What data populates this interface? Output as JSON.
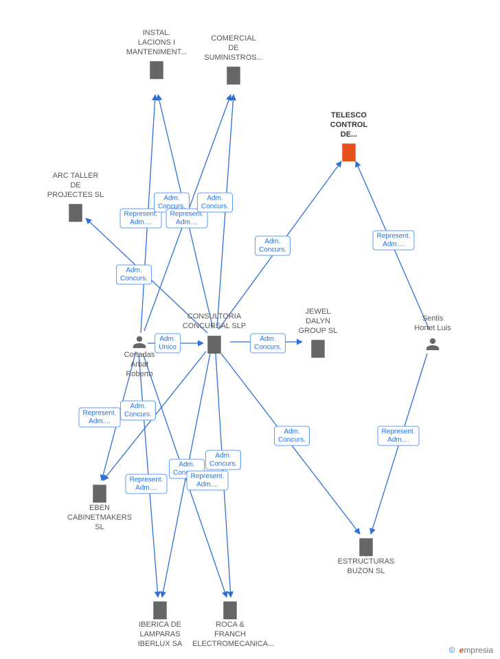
{
  "nodes": {
    "instal": {
      "label": "INSTAL.\nLACIONS I\nMANTENIMENT...",
      "type": "company"
    },
    "comercial": {
      "label": "COMERCIAL\nDE\nSUMINISTROS...",
      "type": "company"
    },
    "telesco": {
      "label": "TELESCO\nCONTROL\nDE...",
      "type": "company",
      "highlight": true
    },
    "arctaller": {
      "label": "ARC TALLER\nDE\nPROJECTES SL",
      "type": "company"
    },
    "consultoria": {
      "label": "CONSULTORIA\nCONCURSAL SLP",
      "type": "company"
    },
    "jewel": {
      "label": "JEWEL\nDALYN\nGROUP SL",
      "type": "company"
    },
    "roberto": {
      "label": "Cortadas\nArbat\nRoberto",
      "type": "person"
    },
    "sentis": {
      "label": "Sentis\nHortet Luis",
      "type": "person"
    },
    "eben": {
      "label": "EBEN\nCABINETMAKERS SL",
      "type": "company"
    },
    "estructuras": {
      "label": "ESTRUCTURAS\nBUZON SL",
      "type": "company"
    },
    "iberica": {
      "label": "IBERICA DE\nLAMPARAS\nIBERLUX SA",
      "type": "company"
    },
    "roca": {
      "label": "ROCA &\nFRANCH\nELECTROMECANICA...",
      "type": "company"
    }
  },
  "edges": {
    "roberto_consultoria": {
      "from": "roberto",
      "to": "consultoria",
      "label": "Adm.\nUnico"
    },
    "consultoria_telesco": {
      "from": "consultoria",
      "to": "telesco",
      "label": "Adm.\nConcurs."
    },
    "sentis_telesco": {
      "from": "sentis",
      "to": "telesco",
      "label": "Represent.\nAdm...."
    },
    "consultoria_jewel": {
      "from": "consultoria",
      "to": "jewel",
      "label": "Adm.\nConcurs."
    },
    "consultoria_estructuras": {
      "from": "consultoria",
      "to": "estructuras",
      "label": "Adm.\nConcurs."
    },
    "sentis_estructuras": {
      "from": "sentis",
      "to": "estructuras",
      "label": "Represent.\nAdm...."
    },
    "consultoria_arctaller": {
      "from": "consultoria",
      "to": "arctaller",
      "label": "Adm.\nConcurs."
    },
    "roberto_instal": {
      "from": "roberto",
      "to": "instal",
      "label": "Represent.\nAdm...."
    },
    "consultoria_instal": {
      "from": "consultoria",
      "to": "instal",
      "label": "Adm.\nConcurs."
    },
    "roberto_comercial": {
      "from": "roberto",
      "to": "comercial",
      "label": "Represent.\nAdm...."
    },
    "consultoria_comercial": {
      "from": "consultoria",
      "to": "comercial",
      "label": "Adm.\nConcurs."
    },
    "roberto_eben": {
      "from": "roberto",
      "to": "eben",
      "label": "Represent.\nAdm...."
    },
    "consultoria_eben": {
      "from": "consultoria",
      "to": "eben",
      "label": "Adm.\nConcurs."
    },
    "roberto_iberica": {
      "from": "roberto",
      "to": "iberica",
      "label": "Represent.\nAdm...."
    },
    "consultoria_iberica": {
      "from": "consultoria",
      "to": "iberica",
      "label": "Adm.\nConcurs."
    },
    "roberto_roca": {
      "from": "roberto",
      "to": "roca",
      "label": "Represent.\nAdm...."
    },
    "consultoria_roca": {
      "from": "consultoria",
      "to": "roca",
      "label": "Adm.\nConcurs."
    }
  },
  "footer": {
    "copyright": "©",
    "brand_e": "e",
    "brand_rest": "mpresia"
  }
}
